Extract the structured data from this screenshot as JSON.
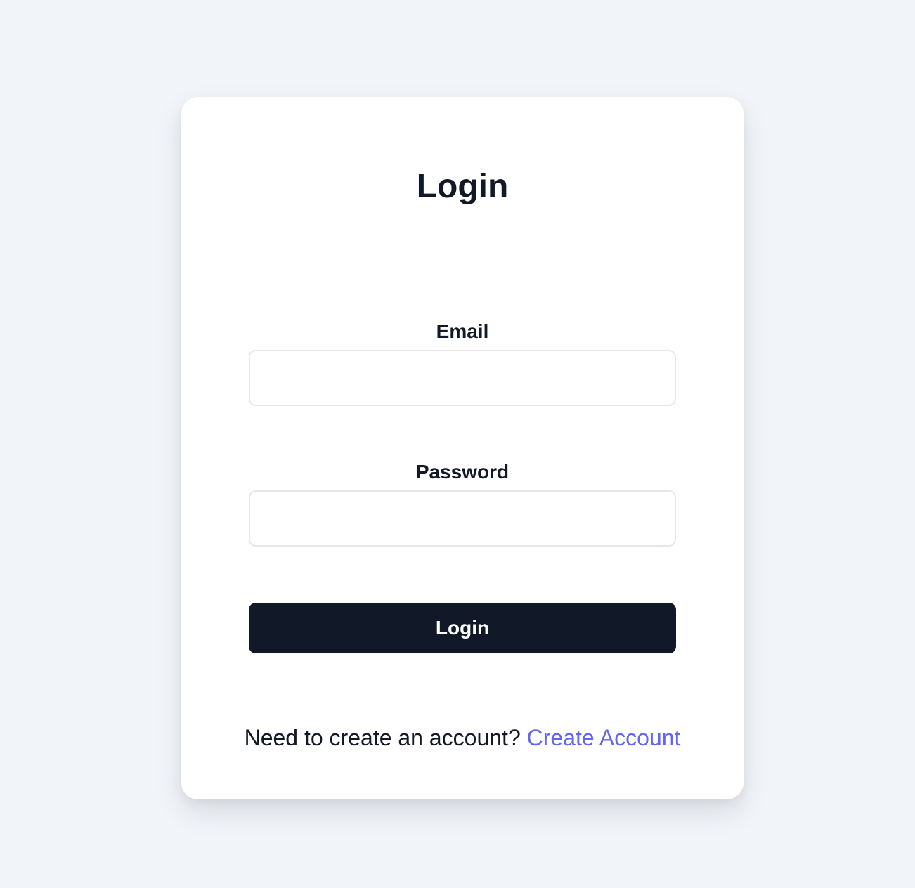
{
  "login_card": {
    "title": "Login",
    "email": {
      "label": "Email",
      "value": "",
      "placeholder": ""
    },
    "password": {
      "label": "Password",
      "value": "",
      "placeholder": ""
    },
    "submit_label": "Login",
    "footer": {
      "prompt": "Need to create an account?",
      "link_label": "Create Account"
    }
  },
  "colors": {
    "background": "#f1f5f9",
    "card": "#ffffff",
    "text": "#111827",
    "button": "#111827",
    "link": "#6366f1",
    "input_border": "#e5e7eb"
  }
}
